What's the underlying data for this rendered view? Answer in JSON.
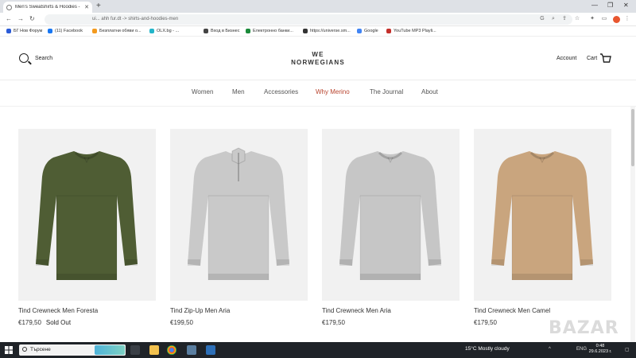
{
  "browser": {
    "tab_title": "Men's Sweatshirts & Hoodies - ",
    "url": "ui...  ahh fur.dt  ->  shirts-and-hoodies-men",
    "bookmarks": [
      {
        "label": "БГ Нов Форум",
        "color": "#2b5bd7"
      },
      {
        "label": "(11) Facebook",
        "color": "#1877f2"
      },
      {
        "label": "Безплатни обяви о...",
        "color": "#f39a1e"
      },
      {
        "label": "OLX.bg - ...",
        "color": "#23b5c9"
      },
      {
        "label": "Вход в Бизнес",
        "color": "#444444"
      },
      {
        "label": "Електронно банки...",
        "color": "#1b8a3a"
      },
      {
        "label": "https://universe.sm...",
        "color": "#333333"
      },
      {
        "label": "Google",
        "color": "#4285f4"
      },
      {
        "label": "YouTube MP3 Playli...",
        "color": "#c4302b"
      }
    ]
  },
  "header": {
    "search_label": "Search",
    "logo_line1": "WE",
    "logo_line2": "NORWEGIANS",
    "account_label": "Account",
    "cart_label": "Cart"
  },
  "nav": {
    "items": [
      "Women",
      "Men",
      "Accessories",
      "Why Merino",
      "The Journal",
      "About"
    ],
    "accent_color": "#b8442e"
  },
  "products": [
    {
      "name": "Tind Crewneck Men Foresta",
      "price": "€179,50",
      "badge": "Sold Out",
      "color": "#4f5d34",
      "style": "crew"
    },
    {
      "name": "Tind Zip-Up Men Aria",
      "price": "€199,50",
      "badge": "",
      "color": "#c9c9c9",
      "style": "zip"
    },
    {
      "name": "Tind Crewneck Men Aria",
      "price": "€179,50",
      "badge": "",
      "color": "#c6c6c6",
      "style": "crew"
    },
    {
      "name": "Tind Crewneck Men Camel",
      "price": "€179,50",
      "badge": "",
      "color": "#c9a57e",
      "style": "crew"
    }
  ],
  "taskbar": {
    "search_placeholder": "Търсене",
    "weather": "15°C  Mostly cloudy",
    "lang": "ENG",
    "time": "0:48",
    "date": "29.6.2023 г."
  },
  "watermark": "BAZAR"
}
